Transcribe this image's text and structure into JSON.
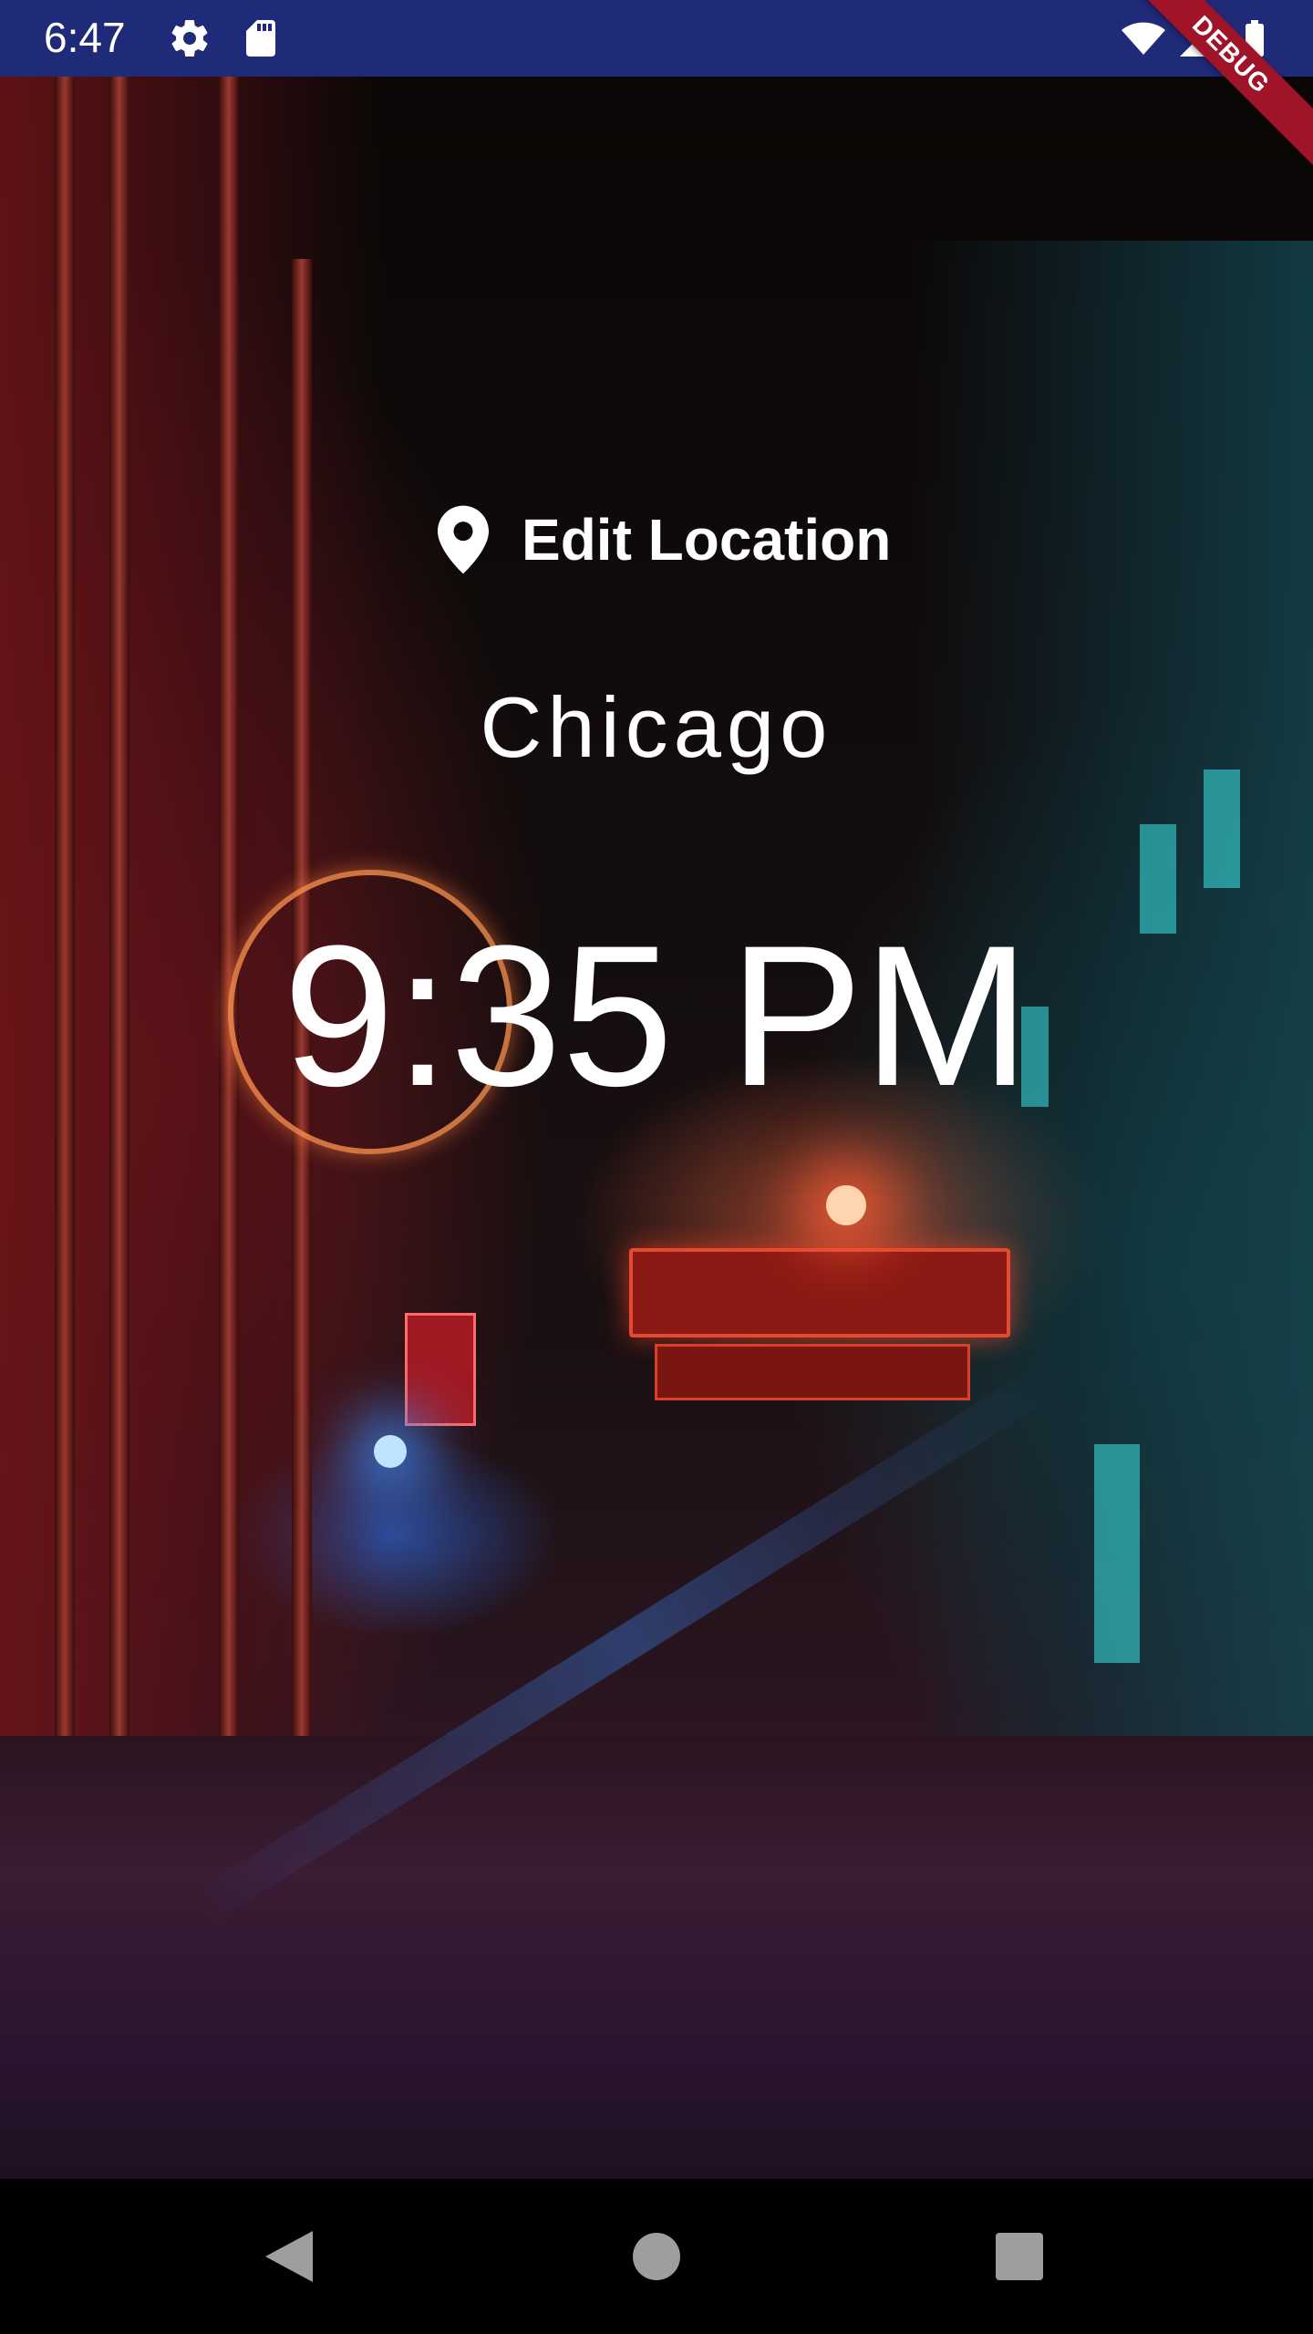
{
  "status_bar": {
    "time": "6:47",
    "left_icons": [
      "gear-icon",
      "sd-card-icon"
    ],
    "right_icons": [
      "wifi-icon",
      "signal-icon",
      "battery-icon"
    ],
    "debug_label": "DEBUG",
    "background": "#1f2a78",
    "ribbon_color": "#a0142a"
  },
  "main": {
    "edit_location_label": "Edit Location",
    "city": "Chicago",
    "time": "9:35 PM"
  },
  "nav_bar": {
    "buttons": [
      "back-icon",
      "home-icon",
      "recents-icon"
    ]
  }
}
